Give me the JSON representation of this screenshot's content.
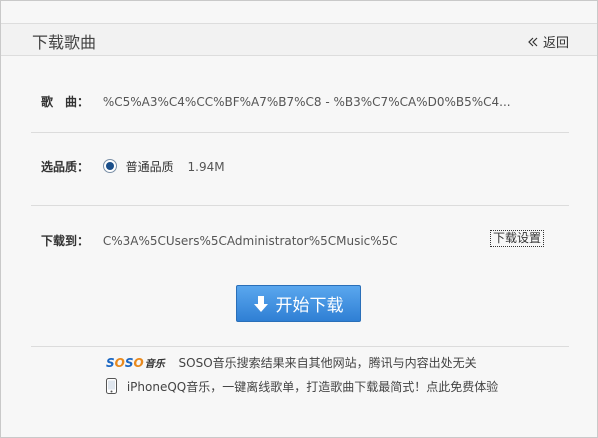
{
  "header": {
    "title": "下载歌曲",
    "back_label": "返回"
  },
  "song": {
    "label": "歌　曲：",
    "value": "%C5%A3%C4%CC%BF%A7%B7%C8 - %B3%C7%CA%D0%B5%C4..."
  },
  "quality": {
    "label": "选品质：",
    "option_label": "普通品质",
    "size": "1.94M"
  },
  "destination": {
    "label": "下载到：",
    "path": "C%3A%5CUsers%5CAdministrator%5CMusic%5C",
    "settings_label": "下载设置"
  },
  "start_button_label": "开始下载",
  "footer": {
    "logo_text_1": "S",
    "logo_text_2": "O",
    "logo_text_3": "S",
    "logo_text_4": "O",
    "logo_music": "音乐",
    "disclaimer": "SOSO音乐搜索结果来自其他网站，腾讯与内容出处无关",
    "promo": "iPhoneQQ音乐，一键离线歌单，打造歌曲下载最简式！点此免费体验"
  },
  "colors": {
    "accent_button": "#3a8ae0",
    "soso_blue": "#1a66c2",
    "soso_orange": "#e8891d"
  }
}
